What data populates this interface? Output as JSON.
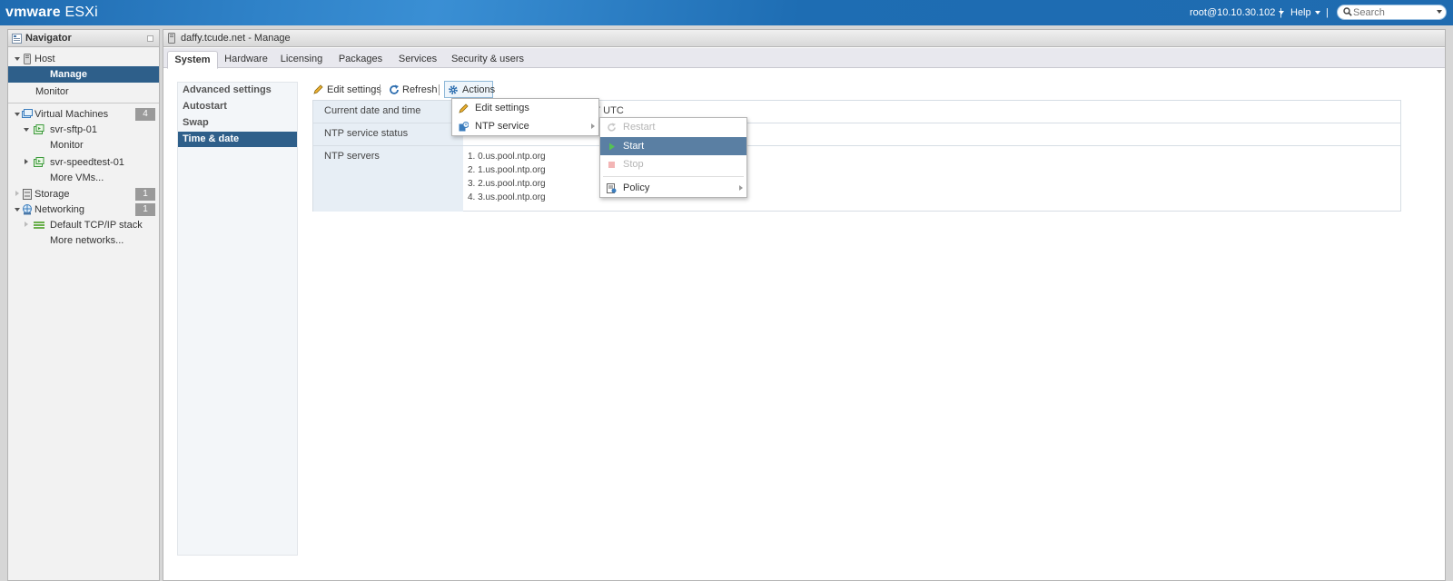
{
  "topbar": {
    "logo_brand": "vmware",
    "logo_product": "ESXi",
    "user": "root@10.10.30.102",
    "help": "Help",
    "separator": "|",
    "search_placeholder": "Search"
  },
  "navigator": {
    "title": "Navigator",
    "items": [
      {
        "label": "Host"
      },
      {
        "label": "Manage"
      },
      {
        "label": "Monitor"
      },
      {
        "label": "Virtual Machines",
        "count": "4"
      },
      {
        "label": "svr-sftp-01"
      },
      {
        "label": "Monitor"
      },
      {
        "label": "svr-speedtest-01"
      },
      {
        "label": "More VMs..."
      },
      {
        "label": "Storage",
        "count": "1"
      },
      {
        "label": "Networking",
        "count": "1"
      },
      {
        "label": "Default TCP/IP stack"
      },
      {
        "label": "More networks..."
      }
    ]
  },
  "main": {
    "title": "daffy.tcude.net - Manage",
    "tabs": [
      {
        "label": "System"
      },
      {
        "label": "Hardware"
      },
      {
        "label": "Licensing"
      },
      {
        "label": "Packages"
      },
      {
        "label": "Services"
      },
      {
        "label": "Security & users"
      }
    ],
    "subnav": [
      {
        "label": "Advanced settings"
      },
      {
        "label": "Autostart"
      },
      {
        "label": "Swap"
      },
      {
        "label": "Time & date"
      }
    ],
    "toolbar": {
      "edit": "Edit settings",
      "refresh": "Refresh",
      "actions": "Actions"
    },
    "info": {
      "row1_label": "Current date and time",
      "row1_value": "7 UTC",
      "row2_label": "NTP service status",
      "row3_label": "NTP servers",
      "ntp_servers": [
        "1. 0.us.pool.ntp.org",
        "2. 1.us.pool.ntp.org",
        "3. 2.us.pool.ntp.org",
        "4. 3.us.pool.ntp.org"
      ]
    }
  },
  "actions_menu": {
    "items": [
      {
        "label": "Edit settings"
      },
      {
        "label": "NTP service"
      }
    ]
  },
  "ntp_submenu": {
    "items": [
      {
        "label": "Restart"
      },
      {
        "label": "Start"
      },
      {
        "label": "Stop"
      },
      {
        "label": "Policy"
      }
    ]
  },
  "colors": {
    "topbar": "#1f6bb0",
    "selection": "#2e5f8a",
    "menu_highlight": "#5a7fa3"
  }
}
